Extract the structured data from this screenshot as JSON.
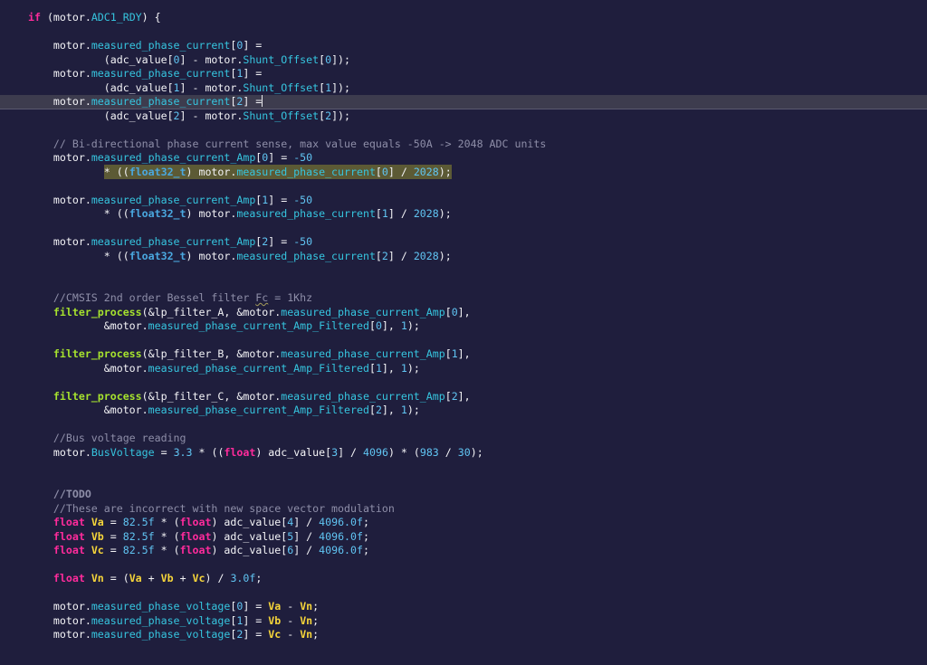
{
  "editor": {
    "highlight_colors": {
      "current_line": "#3d3c4e",
      "selection": "#5c5a35",
      "background": "#1f1e3d"
    },
    "lines": [
      {
        "indent": 0,
        "tokens": [
          [
            "kw",
            "if"
          ],
          [
            "plain",
            " (motor."
          ],
          [
            "prop",
            "ADC1_RDY"
          ],
          [
            "plain",
            ") {"
          ]
        ]
      },
      {
        "indent": 0,
        "tokens": []
      },
      {
        "indent": 4,
        "tokens": [
          [
            "plain",
            "motor."
          ],
          [
            "prop",
            "measured_phase_current"
          ],
          [
            "plain",
            "["
          ],
          [
            "num",
            "0"
          ],
          [
            "plain",
            "] ="
          ]
        ]
      },
      {
        "indent": 12,
        "tokens": [
          [
            "plain",
            "(adc_value["
          ],
          [
            "num",
            "0"
          ],
          [
            "plain",
            "] - motor."
          ],
          [
            "prop",
            "Shunt_Offset"
          ],
          [
            "plain",
            "["
          ],
          [
            "num",
            "0"
          ],
          [
            "plain",
            "]);"
          ]
        ]
      },
      {
        "indent": 4,
        "tokens": [
          [
            "plain",
            "motor."
          ],
          [
            "prop",
            "measured_phase_current"
          ],
          [
            "plain",
            "["
          ],
          [
            "num",
            "1"
          ],
          [
            "plain",
            "] ="
          ]
        ]
      },
      {
        "indent": 12,
        "tokens": [
          [
            "plain",
            "(adc_value["
          ],
          [
            "num",
            "1"
          ],
          [
            "plain",
            "] - motor."
          ],
          [
            "prop",
            "Shunt_Offset"
          ],
          [
            "plain",
            "["
          ],
          [
            "num",
            "1"
          ],
          [
            "plain",
            "]);"
          ]
        ]
      },
      {
        "indent": 4,
        "highlight": "cursor",
        "cursor": true,
        "tokens": [
          [
            "plain",
            "motor."
          ],
          [
            "prop",
            "measured_phase_current"
          ],
          [
            "plain",
            "["
          ],
          [
            "num",
            "2"
          ],
          [
            "plain",
            "] ="
          ]
        ]
      },
      {
        "indent": 12,
        "tokens": [
          [
            "plain",
            "(adc_value["
          ],
          [
            "num",
            "2"
          ],
          [
            "plain",
            "] - motor."
          ],
          [
            "prop",
            "Shunt_Offset"
          ],
          [
            "plain",
            "["
          ],
          [
            "num",
            "2"
          ],
          [
            "plain",
            "]);"
          ]
        ]
      },
      {
        "indent": 0,
        "tokens": []
      },
      {
        "indent": 4,
        "tokens": [
          [
            "comment",
            "// Bi-directional phase current sense, max value equals -50A -> 2048 ADC units"
          ]
        ]
      },
      {
        "indent": 4,
        "tokens": [
          [
            "plain",
            "motor."
          ],
          [
            "prop",
            "measured_phase_current_Amp"
          ],
          [
            "plain",
            "["
          ],
          [
            "num",
            "0"
          ],
          [
            "plain",
            "] = "
          ],
          [
            "num",
            "-50"
          ]
        ]
      },
      {
        "indent": 12,
        "selected": true,
        "tokens": [
          [
            "plain",
            "* (("
          ],
          [
            "type",
            "float32_t"
          ],
          [
            "plain",
            ") motor."
          ],
          [
            "prop",
            "measured_phase_current"
          ],
          [
            "plain",
            "["
          ],
          [
            "num",
            "0"
          ],
          [
            "plain",
            "] / "
          ],
          [
            "num",
            "2028"
          ],
          [
            "plain",
            ");"
          ]
        ]
      },
      {
        "indent": 0,
        "tokens": []
      },
      {
        "indent": 4,
        "tokens": [
          [
            "plain",
            "motor."
          ],
          [
            "prop",
            "measured_phase_current_Amp"
          ],
          [
            "plain",
            "["
          ],
          [
            "num",
            "1"
          ],
          [
            "plain",
            "] = "
          ],
          [
            "num",
            "-50"
          ]
        ]
      },
      {
        "indent": 12,
        "tokens": [
          [
            "plain",
            "* (("
          ],
          [
            "type",
            "float32_t"
          ],
          [
            "plain",
            ") motor."
          ],
          [
            "prop",
            "measured_phase_current"
          ],
          [
            "plain",
            "["
          ],
          [
            "num",
            "1"
          ],
          [
            "plain",
            "] / "
          ],
          [
            "num",
            "2028"
          ],
          [
            "plain",
            ");"
          ]
        ]
      },
      {
        "indent": 0,
        "tokens": []
      },
      {
        "indent": 4,
        "tokens": [
          [
            "plain",
            "motor."
          ],
          [
            "prop",
            "measured_phase_current_Amp"
          ],
          [
            "plain",
            "["
          ],
          [
            "num",
            "2"
          ],
          [
            "plain",
            "] = "
          ],
          [
            "num",
            "-50"
          ]
        ]
      },
      {
        "indent": 12,
        "tokens": [
          [
            "plain",
            "* (("
          ],
          [
            "type",
            "float32_t"
          ],
          [
            "plain",
            ") motor."
          ],
          [
            "prop",
            "measured_phase_current"
          ],
          [
            "plain",
            "["
          ],
          [
            "num",
            "2"
          ],
          [
            "plain",
            "] / "
          ],
          [
            "num",
            "2028"
          ],
          [
            "plain",
            ");"
          ]
        ]
      },
      {
        "indent": 0,
        "tokens": []
      },
      {
        "indent": 0,
        "tokens": []
      },
      {
        "indent": 4,
        "tokens": [
          [
            "comment",
            "//CMSIS 2nd order Bessel filter "
          ],
          [
            "comment-squiggle",
            "Fc"
          ],
          [
            "comment",
            " = 1Khz"
          ]
        ]
      },
      {
        "indent": 4,
        "tokens": [
          [
            "fn",
            "filter_process"
          ],
          [
            "plain",
            "(&lp_filter_A, &motor."
          ],
          [
            "prop",
            "measured_phase_current_Amp"
          ],
          [
            "plain",
            "["
          ],
          [
            "num",
            "0"
          ],
          [
            "plain",
            "],"
          ]
        ]
      },
      {
        "indent": 12,
        "tokens": [
          [
            "plain",
            "&motor."
          ],
          [
            "prop",
            "measured_phase_current_Amp_Filtered"
          ],
          [
            "plain",
            "["
          ],
          [
            "num",
            "0"
          ],
          [
            "plain",
            "], "
          ],
          [
            "num",
            "1"
          ],
          [
            "plain",
            ");"
          ]
        ]
      },
      {
        "indent": 0,
        "tokens": []
      },
      {
        "indent": 4,
        "tokens": [
          [
            "fn",
            "filter_process"
          ],
          [
            "plain",
            "(&lp_filter_B, &motor."
          ],
          [
            "prop",
            "measured_phase_current_Amp"
          ],
          [
            "plain",
            "["
          ],
          [
            "num",
            "1"
          ],
          [
            "plain",
            "],"
          ]
        ]
      },
      {
        "indent": 12,
        "tokens": [
          [
            "plain",
            "&motor."
          ],
          [
            "prop",
            "measured_phase_current_Amp_Filtered"
          ],
          [
            "plain",
            "["
          ],
          [
            "num",
            "1"
          ],
          [
            "plain",
            "], "
          ],
          [
            "num",
            "1"
          ],
          [
            "plain",
            ");"
          ]
        ]
      },
      {
        "indent": 0,
        "tokens": []
      },
      {
        "indent": 4,
        "tokens": [
          [
            "fn",
            "filter_process"
          ],
          [
            "plain",
            "(&lp_filter_C, &motor."
          ],
          [
            "prop",
            "measured_phase_current_Amp"
          ],
          [
            "plain",
            "["
          ],
          [
            "num",
            "2"
          ],
          [
            "plain",
            "],"
          ]
        ]
      },
      {
        "indent": 12,
        "tokens": [
          [
            "plain",
            "&motor."
          ],
          [
            "prop",
            "measured_phase_current_Amp_Filtered"
          ],
          [
            "plain",
            "["
          ],
          [
            "num",
            "2"
          ],
          [
            "plain",
            "], "
          ],
          [
            "num",
            "1"
          ],
          [
            "plain",
            ");"
          ]
        ]
      },
      {
        "indent": 0,
        "tokens": []
      },
      {
        "indent": 4,
        "tokens": [
          [
            "comment",
            "//Bus voltage reading"
          ]
        ]
      },
      {
        "indent": 4,
        "tokens": [
          [
            "plain",
            "motor."
          ],
          [
            "prop",
            "BusVoltage"
          ],
          [
            "plain",
            " = "
          ],
          [
            "num",
            "3.3"
          ],
          [
            "plain",
            " * (("
          ],
          [
            "kw",
            "float"
          ],
          [
            "plain",
            ") adc_value["
          ],
          [
            "num",
            "3"
          ],
          [
            "plain",
            "] / "
          ],
          [
            "num",
            "4096"
          ],
          [
            "plain",
            ") * ("
          ],
          [
            "num",
            "983"
          ],
          [
            "plain",
            " / "
          ],
          [
            "num",
            "30"
          ],
          [
            "plain",
            ");"
          ]
        ]
      },
      {
        "indent": 0,
        "tokens": []
      },
      {
        "indent": 0,
        "tokens": []
      },
      {
        "indent": 4,
        "tokens": [
          [
            "comment-bold",
            "//TODO"
          ]
        ]
      },
      {
        "indent": 4,
        "tokens": [
          [
            "comment",
            "//These are incorrect with new space vector modulation"
          ]
        ]
      },
      {
        "indent": 4,
        "tokens": [
          [
            "kw",
            "float"
          ],
          [
            "plain",
            " "
          ],
          [
            "var",
            "Va"
          ],
          [
            "plain",
            " = "
          ],
          [
            "num",
            "82.5f"
          ],
          [
            "plain",
            " * ("
          ],
          [
            "kw",
            "float"
          ],
          [
            "plain",
            ") adc_value["
          ],
          [
            "num",
            "4"
          ],
          [
            "plain",
            "] / "
          ],
          [
            "num",
            "4096.0f"
          ],
          [
            "plain",
            ";"
          ]
        ]
      },
      {
        "indent": 4,
        "tokens": [
          [
            "kw",
            "float"
          ],
          [
            "plain",
            " "
          ],
          [
            "var",
            "Vb"
          ],
          [
            "plain",
            " = "
          ],
          [
            "num",
            "82.5f"
          ],
          [
            "plain",
            " * ("
          ],
          [
            "kw",
            "float"
          ],
          [
            "plain",
            ") adc_value["
          ],
          [
            "num",
            "5"
          ],
          [
            "plain",
            "] / "
          ],
          [
            "num",
            "4096.0f"
          ],
          [
            "plain",
            ";"
          ]
        ]
      },
      {
        "indent": 4,
        "tokens": [
          [
            "kw",
            "float"
          ],
          [
            "plain",
            " "
          ],
          [
            "var",
            "Vc"
          ],
          [
            "plain",
            " = "
          ],
          [
            "num",
            "82.5f"
          ],
          [
            "plain",
            " * ("
          ],
          [
            "kw",
            "float"
          ],
          [
            "plain",
            ") adc_value["
          ],
          [
            "num",
            "6"
          ],
          [
            "plain",
            "] / "
          ],
          [
            "num",
            "4096.0f"
          ],
          [
            "plain",
            ";"
          ]
        ]
      },
      {
        "indent": 0,
        "tokens": []
      },
      {
        "indent": 4,
        "tokens": [
          [
            "kw",
            "float"
          ],
          [
            "plain",
            " "
          ],
          [
            "var",
            "Vn"
          ],
          [
            "plain",
            " = ("
          ],
          [
            "var",
            "Va"
          ],
          [
            "plain",
            " + "
          ],
          [
            "var",
            "Vb"
          ],
          [
            "plain",
            " + "
          ],
          [
            "var",
            "Vc"
          ],
          [
            "plain",
            ") / "
          ],
          [
            "num",
            "3.0f"
          ],
          [
            "plain",
            ";"
          ]
        ]
      },
      {
        "indent": 0,
        "tokens": []
      },
      {
        "indent": 4,
        "tokens": [
          [
            "plain",
            "motor."
          ],
          [
            "prop",
            "measured_phase_voltage"
          ],
          [
            "plain",
            "["
          ],
          [
            "num",
            "0"
          ],
          [
            "plain",
            "] = "
          ],
          [
            "var",
            "Va"
          ],
          [
            "plain",
            " - "
          ],
          [
            "var",
            "Vn"
          ],
          [
            "plain",
            ";"
          ]
        ]
      },
      {
        "indent": 4,
        "tokens": [
          [
            "plain",
            "motor."
          ],
          [
            "prop",
            "measured_phase_voltage"
          ],
          [
            "plain",
            "["
          ],
          [
            "num",
            "1"
          ],
          [
            "plain",
            "] = "
          ],
          [
            "var",
            "Vb"
          ],
          [
            "plain",
            " - "
          ],
          [
            "var",
            "Vn"
          ],
          [
            "plain",
            ";"
          ]
        ]
      },
      {
        "indent": 4,
        "tokens": [
          [
            "plain",
            "motor."
          ],
          [
            "prop",
            "measured_phase_voltage"
          ],
          [
            "plain",
            "["
          ],
          [
            "num",
            "2"
          ],
          [
            "plain",
            "] = "
          ],
          [
            "var",
            "Vc"
          ],
          [
            "plain",
            " - "
          ],
          [
            "var",
            "Vn"
          ],
          [
            "plain",
            ";"
          ]
        ]
      }
    ]
  }
}
